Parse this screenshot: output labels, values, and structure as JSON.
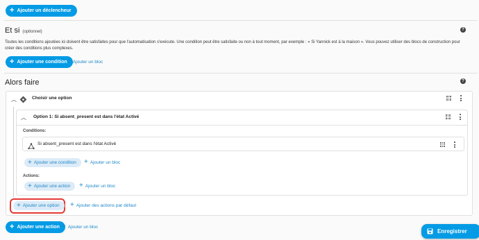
{
  "top": {
    "add_trigger_label": "Ajouter un déclencheur"
  },
  "conditions": {
    "title": "Et si",
    "optional": "(optionnel)",
    "description_line1": "Toutes les conditions ajoutées ici doivent être satisfaites pour que l'automatisation s'exécute. Une condition peut être satisfaite ou non à tout moment, par exemple : « Si Yannick est à la maison ». Vous pouvez utiliser des blocs de construction pour",
    "description_line2": "créer des conditions plus complexes.",
    "add_condition_label": "Ajouter une condition",
    "add_block_label": "Ajouter un bloc"
  },
  "actions": {
    "title": "Alors faire",
    "choose_card": {
      "title": "Choisir une option",
      "option1": {
        "title": "Option 1: Si absent_present est dans l'état Activé",
        "conditions_label": "Conditions:",
        "condition_item": "Si absent_present est dans l'état Activé",
        "add_condition_label": "Ajouter une condition",
        "add_block_label": "Ajouter un bloc",
        "actions_label": "Actions:",
        "add_action_label": "Ajouter une action",
        "add_block2_label": "Ajouter un bloc"
      },
      "add_option_label": "Ajouter une option",
      "add_default_label": "Ajouter des actions par défaut"
    },
    "add_action_label": "Ajouter une action",
    "add_block_label": "Ajouter un bloc"
  },
  "save_label": "Enregistrer",
  "colors": {
    "accent": "#039be5",
    "highlight": "#e53935"
  }
}
